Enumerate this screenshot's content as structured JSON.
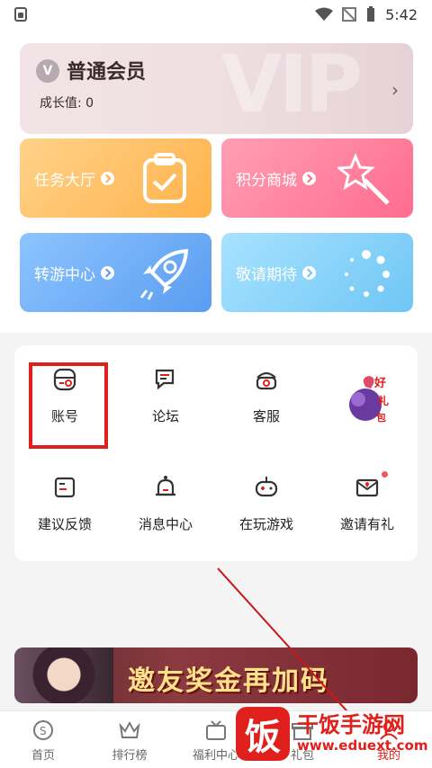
{
  "status_bar": {
    "time": "5:42"
  },
  "member": {
    "badge": "V",
    "level": "普通会员",
    "growth": "成长值: 0",
    "watermark": "VIP"
  },
  "tiles": [
    {
      "label": "任务大厅",
      "icon": "clipboard-check-icon"
    },
    {
      "label": "积分商城",
      "icon": "magic-wand-icon"
    },
    {
      "label": "转游中心",
      "icon": "rocket-icon"
    },
    {
      "label": "敬请期待",
      "icon": "loading-icon"
    }
  ],
  "grid": [
    {
      "label": "账号",
      "icon": "account-icon"
    },
    {
      "label": "论坛",
      "icon": "forum-icon"
    },
    {
      "label": "客服",
      "icon": "customer-service-icon"
    },
    {
      "label": "",
      "icon": "promo-game-icon"
    },
    {
      "label": "建议反馈",
      "icon": "feedback-icon"
    },
    {
      "label": "消息中心",
      "icon": "bell-icon"
    },
    {
      "label": "在玩游戏",
      "icon": "gamepad-icon"
    },
    {
      "label": "邀请有礼",
      "icon": "invite-mail-icon"
    }
  ],
  "banner": {
    "text": "邀友奖金再加码"
  },
  "nav": [
    {
      "label": "首页",
      "icon": "home-coin-icon"
    },
    {
      "label": "排行榜",
      "icon": "crown-icon"
    },
    {
      "label": "福利中心",
      "icon": "gift-tv-icon"
    },
    {
      "label": "礼包",
      "icon": "gift-box-icon"
    },
    {
      "label": "我的",
      "icon": "profile-icon"
    }
  ],
  "watermark": {
    "glyph": "饭",
    "name": "干饭手游网",
    "url": "www.eduext.com"
  },
  "colors": {
    "highlight": "#e0201c",
    "task_tile": "#ffb24a",
    "shop_tile": "#ff6b8e",
    "transfer_tile": "#5a9cf0",
    "soon_tile": "#6fc6f5"
  }
}
